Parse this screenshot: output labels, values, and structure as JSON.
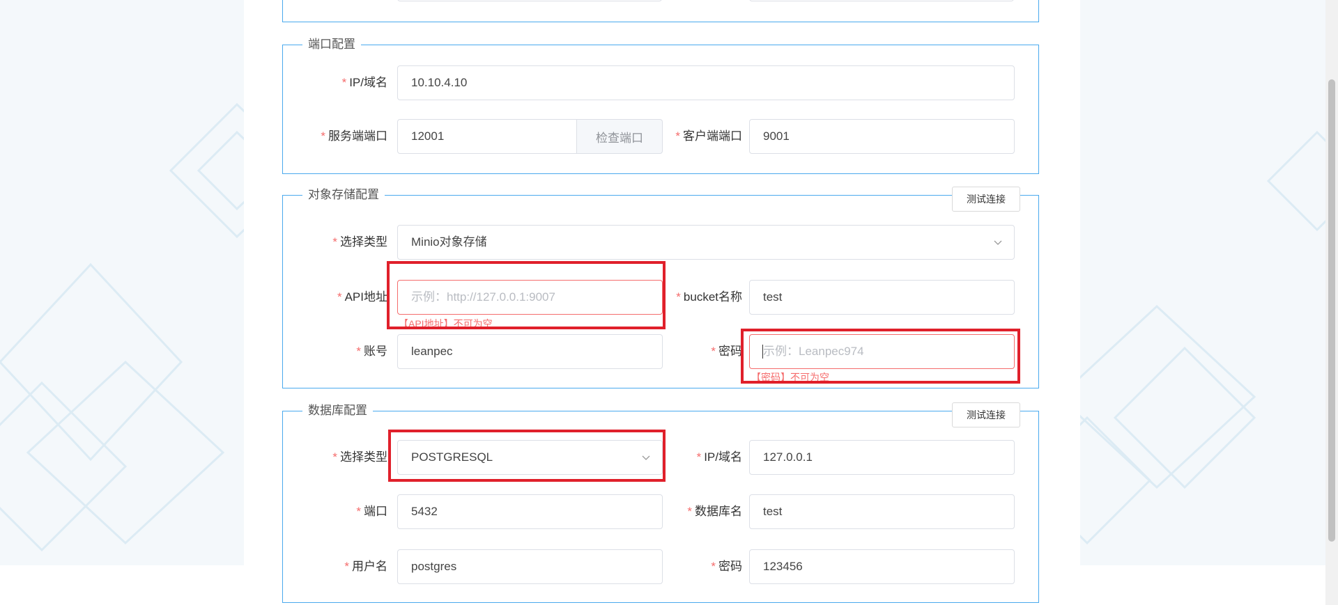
{
  "port_config": {
    "legend": "端口配置",
    "ip_label": "IP/域名",
    "ip_value": "10.10.4.10",
    "server_port_label": "服务端端口",
    "server_port_value": "12001",
    "check_port_label": "检查端口",
    "client_port_label": "客户端端口",
    "client_port_value": "9001"
  },
  "storage_config": {
    "legend": "对象存储配置",
    "test_button": "测试连接",
    "type_label": "选择类型",
    "type_value": "Minio对象存储",
    "api_label": "API地址",
    "api_placeholder": "示例：http://127.0.0.1:9007",
    "api_error": "【API地址】不可为空",
    "bucket_label": "bucket名称",
    "bucket_value": "test",
    "account_label": "账号",
    "account_value": "leanpec",
    "password_label": "密码",
    "password_placeholder": "示例：Leanpec974",
    "password_error": "【密码】不可为空"
  },
  "db_config": {
    "legend": "数据库配置",
    "test_button": "测试连接",
    "type_label": "选择类型",
    "type_value": "POSTGRESQL",
    "ip_label": "IP/域名",
    "ip_value": "127.0.0.1",
    "port_label": "端口",
    "port_value": "5432",
    "dbname_label": "数据库名",
    "dbname_value": "test",
    "user_label": "用户名",
    "user_value": "postgres",
    "password_label": "密码",
    "password_value": "123456"
  },
  "required_mark": "*",
  "icons": {
    "select_arrow": "chevron-down-icon"
  },
  "colors": {
    "section_border": "#49a9ee",
    "required": "#f56c6c",
    "highlight_box": "#e0202b"
  }
}
